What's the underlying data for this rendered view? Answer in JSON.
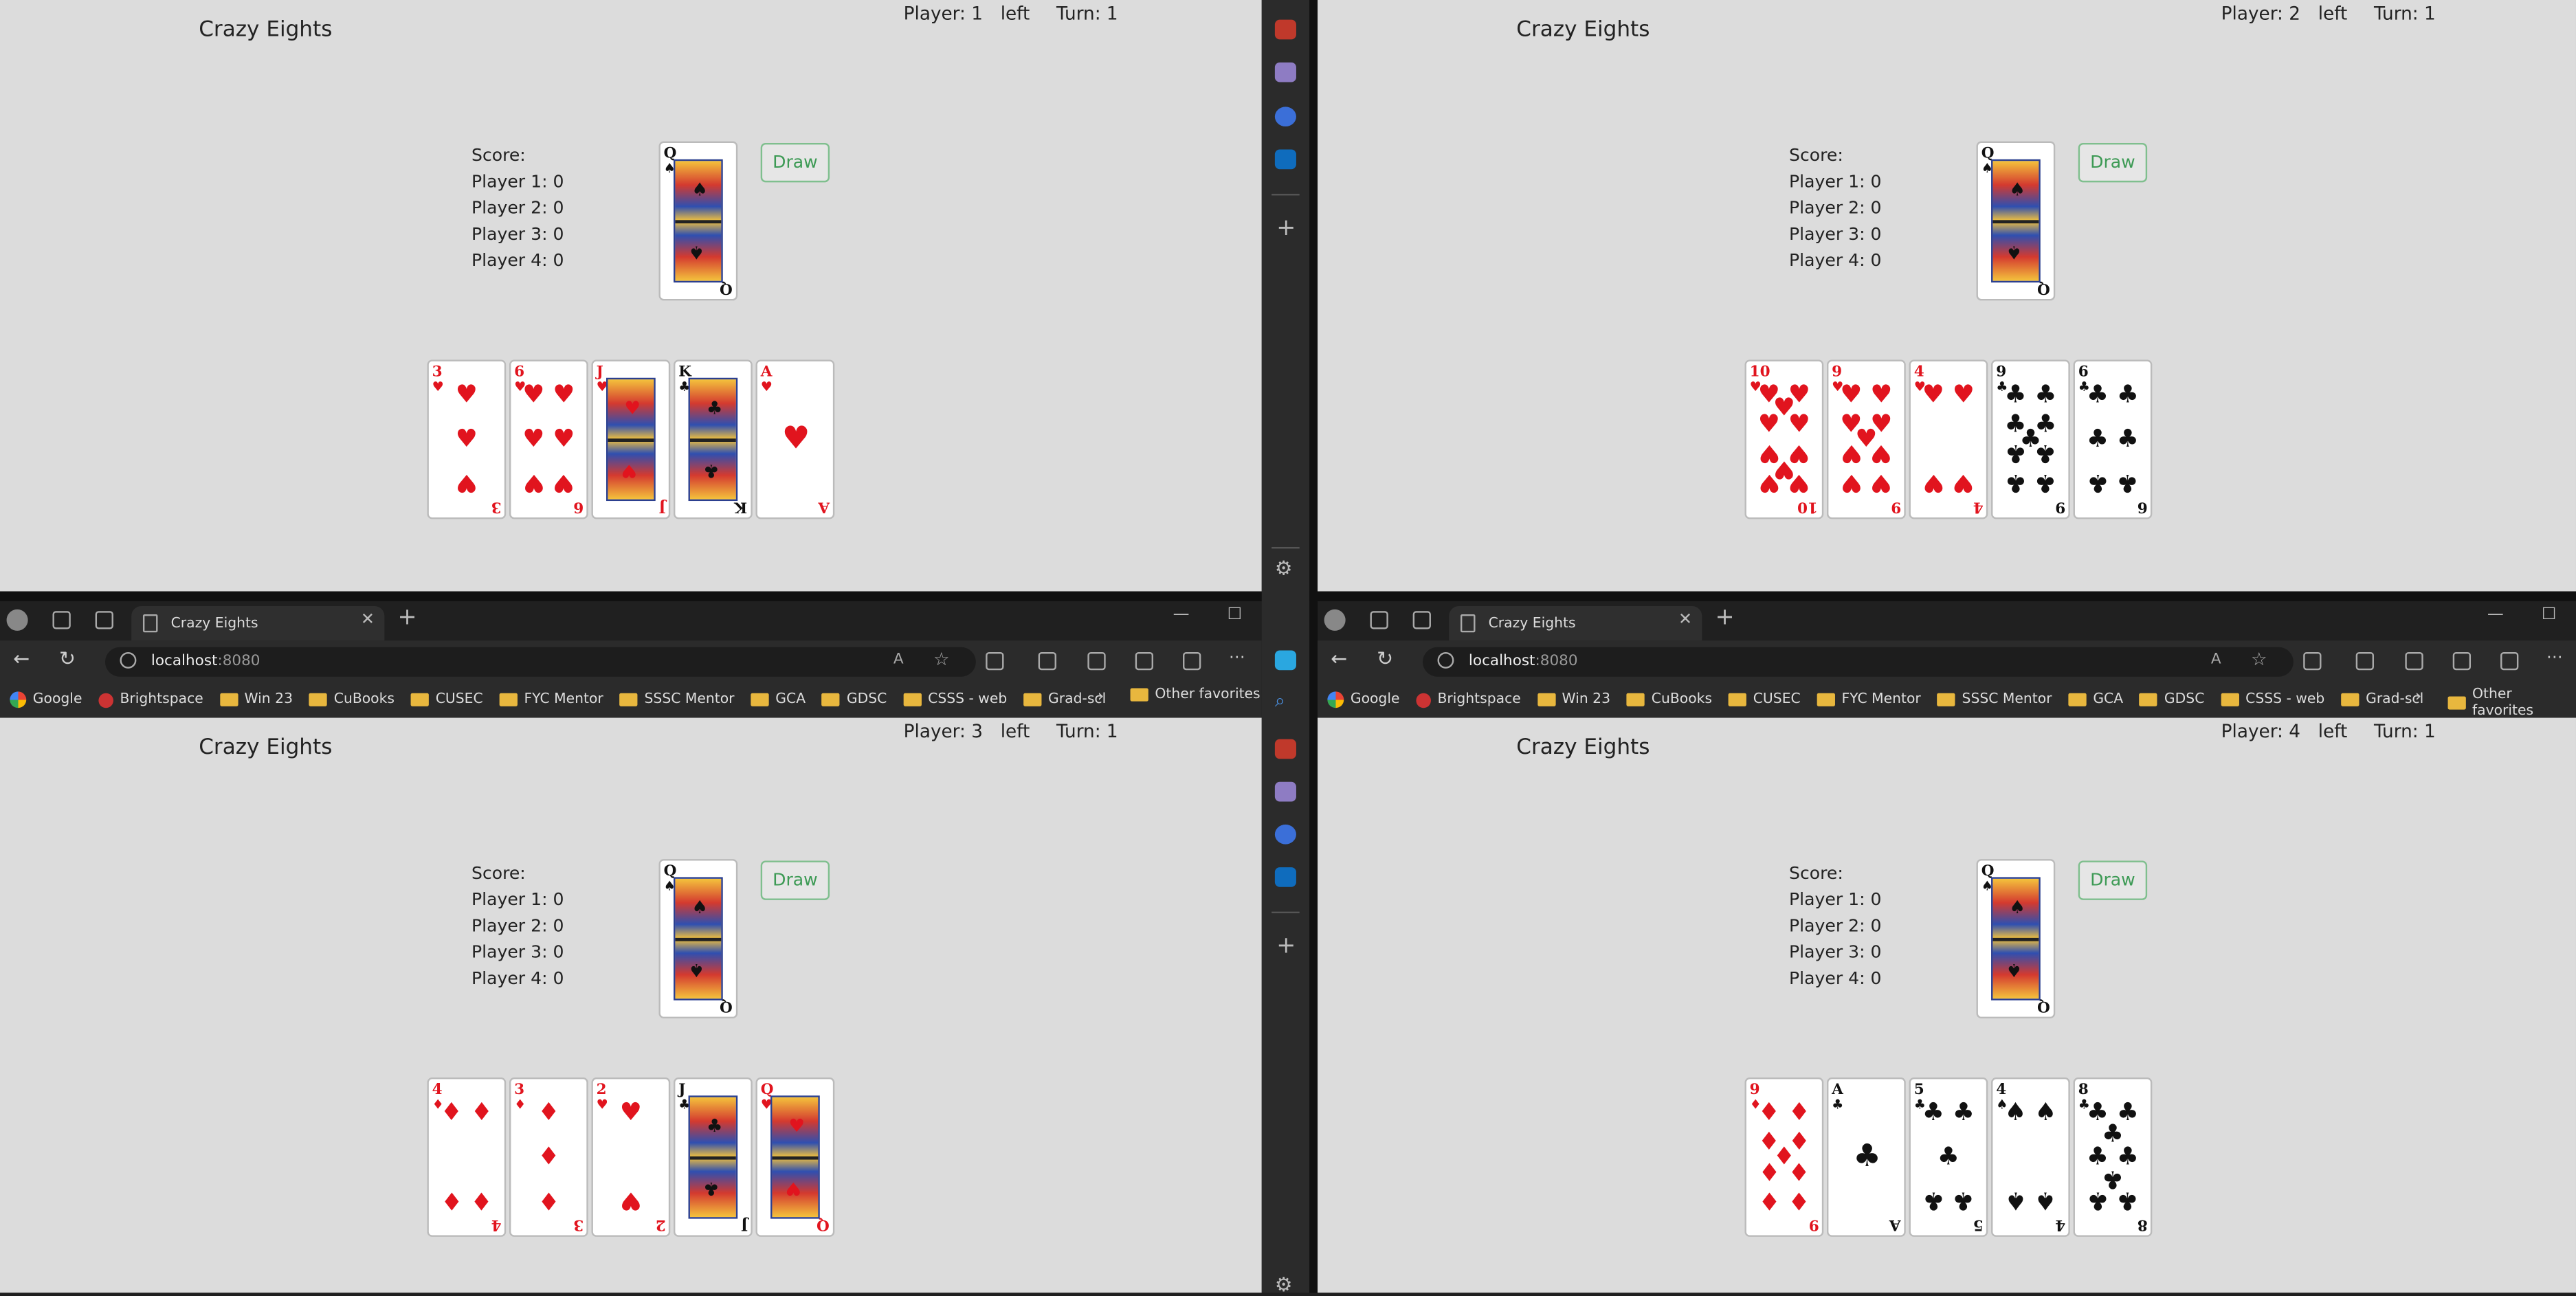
{
  "sidebar_apps": [
    "toolbox-icon",
    "chess-icon",
    "copilot-icon",
    "outlook-icon"
  ],
  "browser": {
    "tab_title": "Crazy Eights",
    "address_host": "localhost",
    "address_port": ":8080",
    "bookmarks": [
      "Google",
      "Brightspace",
      "Win 23",
      "CuBooks",
      "CUSEC",
      "FYC Mentor",
      "SSSC Mentor",
      "GCA",
      "GDSC",
      "CSSS - web",
      "Grad-scl"
    ],
    "other_favorites": "Other favorites"
  },
  "labels": {
    "title": "Crazy Eights",
    "left": "left",
    "draw": "Draw",
    "score_header": "Score:"
  },
  "scores": [
    "Player 1: 0",
    "Player 2: 0",
    "Player 3: 0",
    "Player 4: 0"
  ],
  "discard": {
    "rank": "Q",
    "suit": "♠"
  },
  "colors": {
    "red_suit": "#e1141e",
    "draw_button": "#3d9a55",
    "folder": "#e8b73e"
  },
  "players": [
    {
      "player_label": "Player: 1",
      "turn_label": "Turn: 1",
      "hand": [
        {
          "rank": "3",
          "suit": "♥"
        },
        {
          "rank": "6",
          "suit": "♥"
        },
        {
          "rank": "J",
          "suit": "♥"
        },
        {
          "rank": "K",
          "suit": "♣"
        },
        {
          "rank": "A",
          "suit": "♥"
        }
      ]
    },
    {
      "player_label": "Player: 2",
      "turn_label": "Turn: 1",
      "hand": [
        {
          "rank": "10",
          "suit": "♥"
        },
        {
          "rank": "9",
          "suit": "♥"
        },
        {
          "rank": "4",
          "suit": "♥"
        },
        {
          "rank": "9",
          "suit": "♣"
        },
        {
          "rank": "6",
          "suit": "♣"
        }
      ]
    },
    {
      "player_label": "Player: 3",
      "turn_label": "Turn: 1",
      "hand": [
        {
          "rank": "4",
          "suit": "♦"
        },
        {
          "rank": "3",
          "suit": "♦"
        },
        {
          "rank": "2",
          "suit": "♥"
        },
        {
          "rank": "J",
          "suit": "♣"
        },
        {
          "rank": "Q",
          "suit": "♥"
        }
      ]
    },
    {
      "player_label": "Player: 4",
      "turn_label": "Turn: 1",
      "hand": [
        {
          "rank": "9",
          "suit": "♦"
        },
        {
          "rank": "A",
          "suit": "♣"
        },
        {
          "rank": "5",
          "suit": "♣"
        },
        {
          "rank": "4",
          "suit": "♠"
        },
        {
          "rank": "8",
          "suit": "♣"
        }
      ]
    }
  ]
}
